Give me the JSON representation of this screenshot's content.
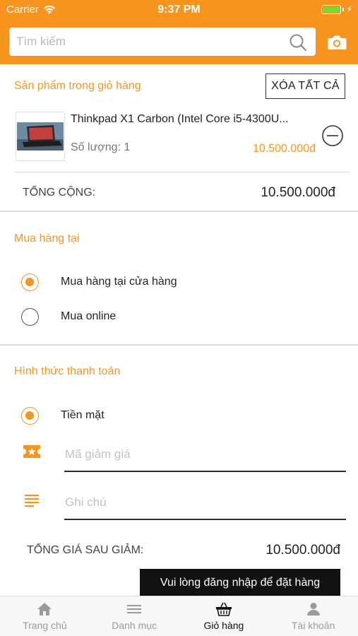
{
  "status_bar": {
    "carrier": "Carrier",
    "time": "9:37 PM"
  },
  "search": {
    "placeholder": "Tìm kiếm",
    "value": ""
  },
  "cart": {
    "title": "Sản phẩm trong giỏ hàng",
    "clear_all_label": "XÓA TẤT CẢ",
    "item": {
      "name": "Thinkpad X1 Carbon (Intel Core i5-4300U...",
      "quantity": "Số lượng: 1",
      "price": "10.500.000đ"
    },
    "total_label": "TỔNG CỘNG:",
    "total_value": "10.500.000đ"
  },
  "purchase": {
    "title": "Mua hàng tại",
    "options": [
      {
        "label": "Mua hàng tại cửa hàng",
        "selected": true
      },
      {
        "label": "Mua online",
        "selected": false
      }
    ]
  },
  "payment": {
    "title": "Hình thức thanh toán",
    "method": {
      "label": "Tiền mặt",
      "selected": true
    },
    "coupon_placeholder": "Mã giảm giá",
    "coupon_value": "",
    "note_placeholder": "Ghi chú",
    "note_value": "",
    "final_total_label": "TỔNG GIÁ SAU GIẢM:",
    "final_total_value": "10.500.000đ"
  },
  "toast": "Vui lòng đăng nhập để đặt hàng",
  "tabs": [
    {
      "label": "Trang chủ",
      "icon": "home-icon",
      "active": false
    },
    {
      "label": "Danh mục",
      "icon": "menu-icon",
      "active": false
    },
    {
      "label": "Giỏ hàng",
      "icon": "basket-icon",
      "active": true
    },
    {
      "label": "Tài khoản",
      "icon": "user-icon",
      "active": false
    }
  ],
  "colors": {
    "accent": "#f7941d",
    "text": "#222222",
    "muted": "#9b9b9b"
  }
}
